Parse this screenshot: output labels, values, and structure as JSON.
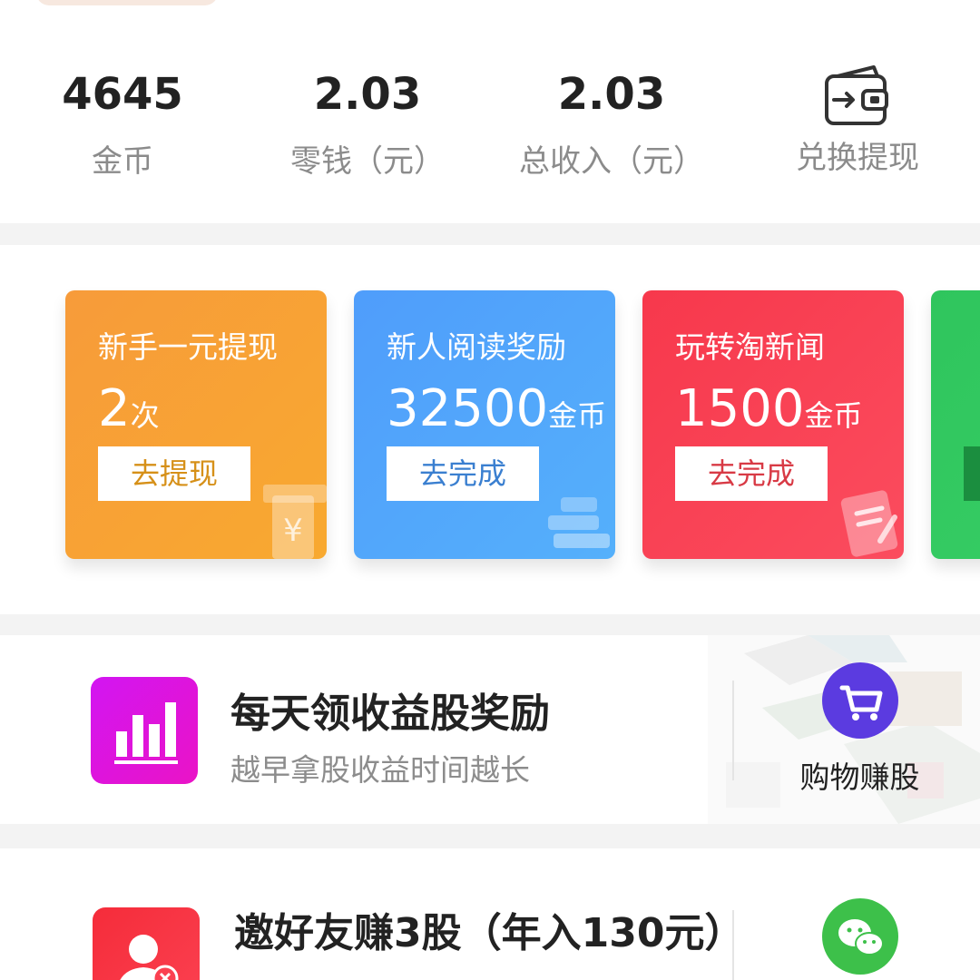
{
  "stats": [
    {
      "value": "4645",
      "label": "金币"
    },
    {
      "value": "2.03",
      "label": "零钱（元）"
    },
    {
      "value": "2.03",
      "label": "总收入（元）"
    }
  ],
  "exchange": {
    "label": "兑换提现",
    "icon": "wallet-icon"
  },
  "task_cards": [
    {
      "title": "新手一元提现",
      "amount": "2",
      "unit": "次",
      "button": "去提现",
      "color": "#f79b3a"
    },
    {
      "title": "新人阅读奖励",
      "amount": "32500",
      "unit": "金币",
      "button": "去完成",
      "color": "#4f9dfb"
    },
    {
      "title": "玩转淘新闻",
      "amount": "1500",
      "unit": "金币",
      "button": "去完成",
      "color": "#f7384c"
    },
    {
      "title": "",
      "amount": "",
      "unit": "",
      "button": "",
      "color": "#2fc55d"
    }
  ],
  "banner": {
    "title": "每天领收益股奖励",
    "subtitle": "越早拿股收益时间越长",
    "side_label": "购物赚股",
    "side_icon": "shopping-cart-icon",
    "icon": "bar-chart-icon",
    "icon_color": "#d215f2",
    "side_color": "#5b3be0"
  },
  "invite": {
    "title": "邀好友赚3股（年入130元）",
    "icon": "user-icon",
    "icon_color": "#f52c3a",
    "side_icon": "wechat-icon",
    "side_color": "#3dc04a"
  }
}
